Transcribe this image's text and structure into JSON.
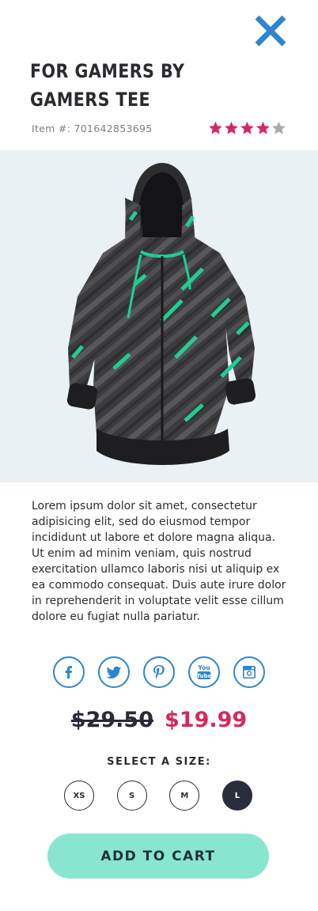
{
  "product": {
    "title": "FOR GAMERS BY GAMERS TEE",
    "item_number_label": "Item #: 701642853695",
    "rating": 4,
    "rating_max": 5,
    "description": "Lorem ipsum dolor sit amet, consectetur adipisicing elit, sed do eiusmod tempor incididunt ut labore et dolore magna aliqua. Ut enim ad minim veniam, quis nostrud exercitation ullamco laboris nisi ut aliquip ex ea commodo consequat. Duis aute irure dolor in reprehenderit in voluptate velit esse cillum dolore eu fugiat nulla pariatur.",
    "price_original": "$29.50",
    "price_sale": "$19.99"
  },
  "social": [
    {
      "name": "facebook-icon"
    },
    {
      "name": "twitter-icon"
    },
    {
      "name": "pinterest-icon"
    },
    {
      "name": "youtube-icon"
    },
    {
      "name": "instagram-icon"
    }
  ],
  "sizes": {
    "label": "SELECT A SIZE:",
    "options": [
      "XS",
      "S",
      "M",
      "L"
    ],
    "selected": "L"
  },
  "cart": {
    "button_label": "ADD TO CART"
  },
  "colors": {
    "accent_blue": "#2f86cc",
    "star_filled": "#d6285a",
    "star_empty": "#a9a9ad",
    "sale_price": "#d6285a",
    "cart_button": "#88e6cf",
    "selected_size": "#2a2d3c",
    "image_background": "#e9f1f5",
    "hoodie_stripe": "#1fcf92"
  }
}
